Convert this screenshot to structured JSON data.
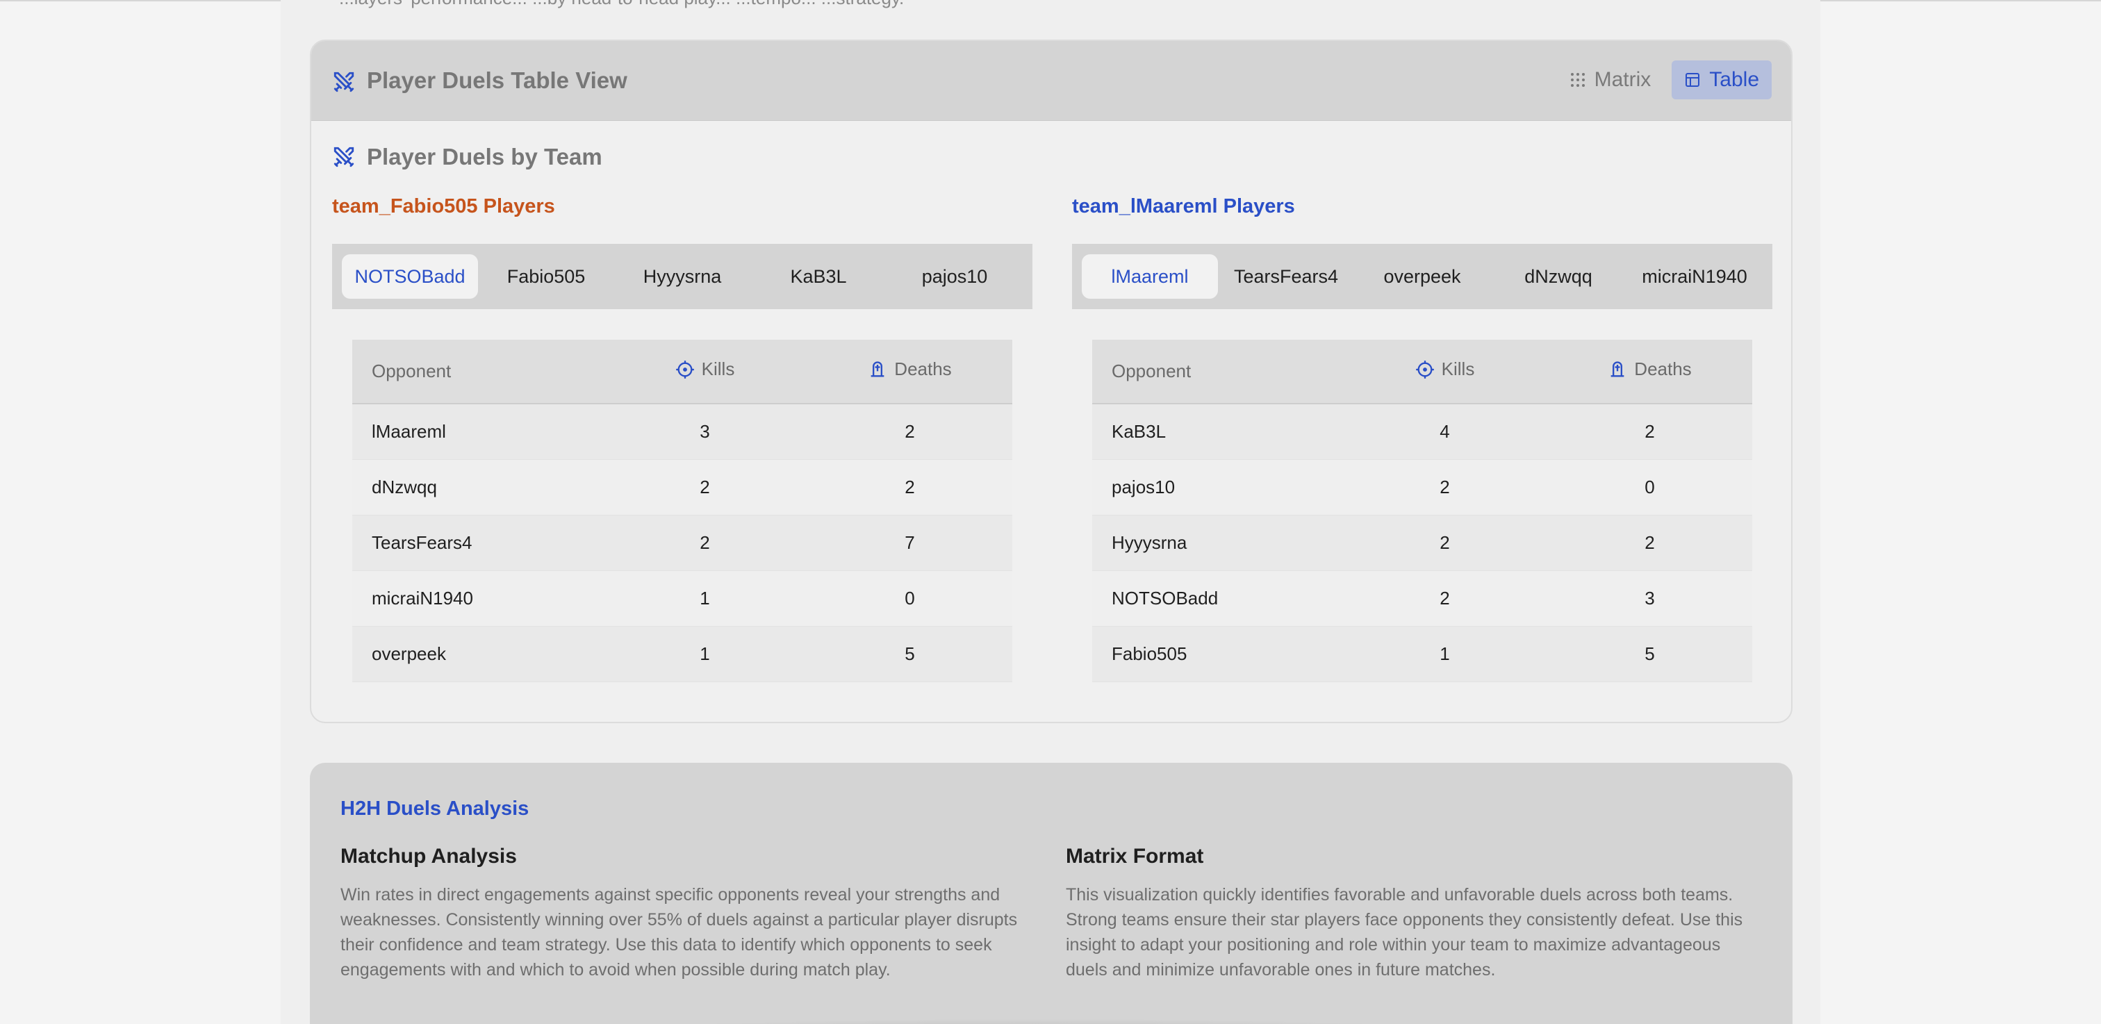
{
  "header": {
    "faded_text": "...layers' performance... ...by head-to-head play... ...tempo... ...strategy."
  },
  "card": {
    "title": "Player Duels Table View",
    "toggle": {
      "matrix_label": "Matrix",
      "table_label": "Table",
      "active": "Table"
    },
    "section_title": "Player Duels by Team"
  },
  "teams": [
    {
      "label": "team_Fabio505 Players",
      "color": "#c6541c",
      "players": [
        "NOTSOBadd",
        "Fabio505",
        "Hyyysrna",
        "KaB3L",
        "pajos10"
      ],
      "active_player": "NOTSOBadd",
      "headers": {
        "opponent": "Opponent",
        "kills": "Kills",
        "deaths": "Deaths"
      },
      "rows": [
        {
          "opponent": "lMaareml",
          "kills": "3",
          "deaths": "2"
        },
        {
          "opponent": "dNzwqq",
          "kills": "2",
          "deaths": "2"
        },
        {
          "opponent": "TearsFears4",
          "kills": "2",
          "deaths": "7"
        },
        {
          "opponent": "micraiN1940",
          "kills": "1",
          "deaths": "0"
        },
        {
          "opponent": "overpeek",
          "kills": "1",
          "deaths": "5"
        }
      ]
    },
    {
      "label": "team_lMaareml Players",
      "color": "#2a4fc7",
      "players": [
        "lMaareml",
        "TearsFears4",
        "overpeek",
        "dNzwqq",
        "micraiN1940"
      ],
      "active_player": "lMaareml",
      "headers": {
        "opponent": "Opponent",
        "kills": "Kills",
        "deaths": "Deaths"
      },
      "rows": [
        {
          "opponent": "KaB3L",
          "kills": "4",
          "deaths": "2"
        },
        {
          "opponent": "pajos10",
          "kills": "2",
          "deaths": "0"
        },
        {
          "opponent": "Hyyysrna",
          "kills": "2",
          "deaths": "2"
        },
        {
          "opponent": "NOTSOBadd",
          "kills": "2",
          "deaths": "3"
        },
        {
          "opponent": "Fabio505",
          "kills": "1",
          "deaths": "5"
        }
      ]
    }
  ],
  "analysis": {
    "title": "H2H Duels Analysis",
    "left_heading": "Matchup Analysis",
    "left_text": "Win rates in direct engagements against specific opponents reveal your strengths and weaknesses. Consistently winning over 55% of duels against a particular player disrupts their confidence and team strategy. Use this data to identify which opponents to seek engagements with and which to avoid when possible during match play.",
    "right_heading": "Matrix Format",
    "right_text": "This visualization quickly identifies favorable and unfavorable duels across both teams. Strong teams ensure their star players face opponents they consistently defeat. Use this insight to adapt your positioning and role within your team to maximize advantageous duels and minimize unfavorable ones in future matches."
  },
  "icons": {
    "card_title": "crossed-swords-icon",
    "matrix": "grid-dots-icon",
    "table": "table-icon",
    "kills": "crosshair-icon",
    "deaths": "tombstone-icon"
  },
  "colors": {
    "accent": "#2a4fc7",
    "team_orange": "#c6541c"
  }
}
